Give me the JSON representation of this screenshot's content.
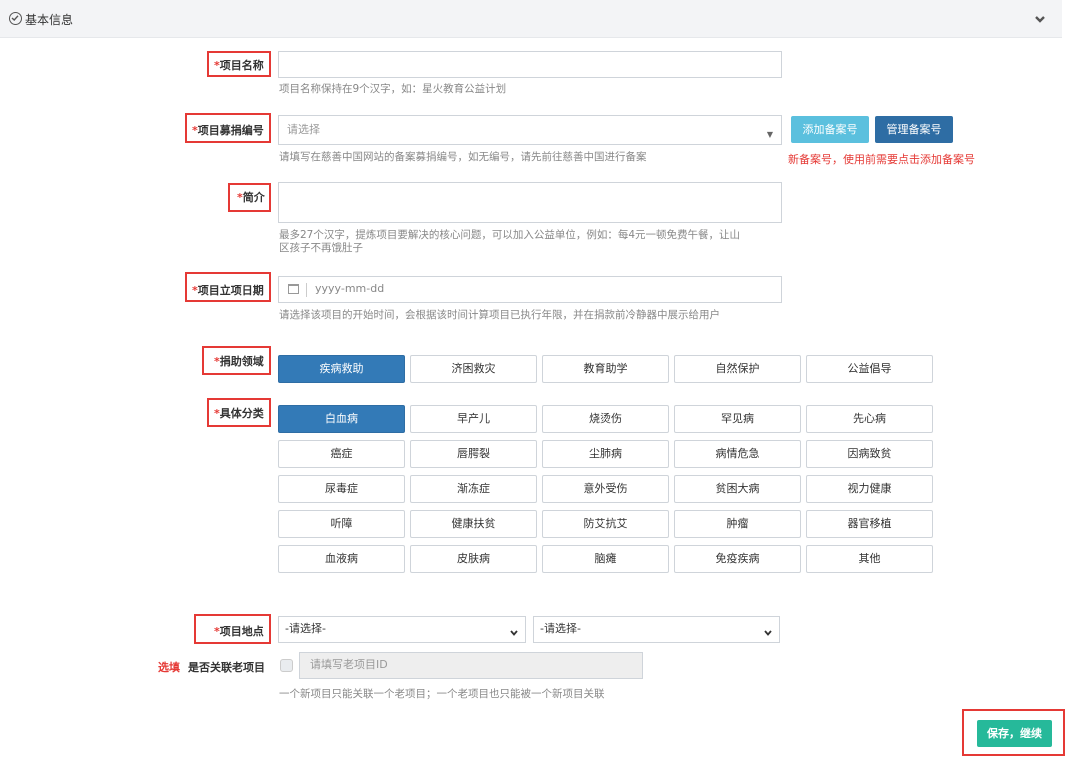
{
  "header": {
    "title": "基本信息"
  },
  "fields": {
    "name": {
      "required_mark": "*",
      "label": "项目名称",
      "value": "",
      "hint": "项目名称保持在9个汉字，如：星火教育公益计划"
    },
    "code": {
      "required_mark": "*",
      "label": "项目募捐编号",
      "placeholder": "请选择",
      "hint": "请填写在慈善中国网站的备案募捐编号，如无编号，请先前往慈善中国进行备案",
      "add_btn": "添加备案号",
      "manage_btn": "管理备案号",
      "warning": "新备案号，使用前需要点击添加备案号"
    },
    "intro": {
      "required_mark": "*",
      "label": "简介",
      "hint_line1": "最多27个汉字，提炼项目要解决的核心问题，可以加入公益单位，例如：每4元一顿免费午餐，让山",
      "hint_line2": "区孩子不再饿肚子"
    },
    "date": {
      "required_mark": "*",
      "label": "项目立项日期",
      "placeholder": "yyyy-mm-dd",
      "hint": "请选择该项目的开始时间，会根据该时间计算项目已执行年限，并在捐款前冷静器中展示给用户"
    },
    "field": {
      "required_mark": "*",
      "label": "捐助领域",
      "options": [
        "疾病救助",
        "济困救灾",
        "教育助学",
        "自然保护",
        "公益倡导"
      ],
      "selected": "疾病救助"
    },
    "category": {
      "required_mark": "*",
      "label": "具体分类",
      "options": [
        "白血病",
        "早产儿",
        "烧烫伤",
        "罕见病",
        "先心病",
        "癌症",
        "唇腭裂",
        "尘肺病",
        "病情危急",
        "因病致贫",
        "尿毒症",
        "渐冻症",
        "意外受伤",
        "贫困大病",
        "视力健康",
        "听障",
        "健康扶贫",
        "防艾抗艾",
        "肿瘤",
        "器官移植",
        "血液病",
        "皮肤病",
        "脑瘫",
        "免疫疾病",
        "其他"
      ],
      "selected": "白血病"
    },
    "location": {
      "required_mark": "*",
      "label": "项目地点",
      "province": "-请选择-",
      "city": "-请选择-"
    },
    "link": {
      "optional_tag": "选填",
      "label": "是否关联老项目",
      "placeholder": "请填写老项目ID",
      "hint": "一个新项目只能关联一个老项目；一个老项目也只能被一个新项目关联"
    }
  },
  "actions": {
    "save": "保存，继续"
  },
  "colors": {
    "primary": "#337ab7",
    "required": "#e53935",
    "save": "#26b99a",
    "info": "#5bc0de"
  }
}
